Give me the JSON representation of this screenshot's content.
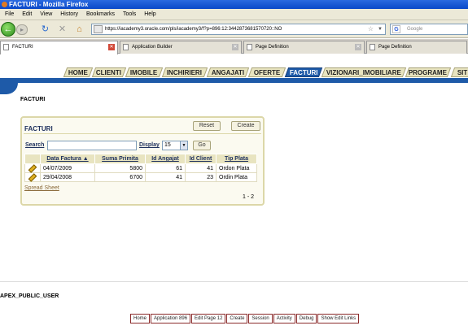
{
  "window": {
    "title": "FACTURI - Mozilla Firefox"
  },
  "menu": [
    "File",
    "Edit",
    "View",
    "History",
    "Bookmarks",
    "Tools",
    "Help"
  ],
  "nav": {
    "url": "https://iacademy3.oracle.com/pls/iacademy3/f?p=896:12:3442873681570720::NO",
    "search_placeholder": "Google"
  },
  "browser_tabs": [
    {
      "label": "FACTURI",
      "active": true
    },
    {
      "label": "Application Builder",
      "active": false
    },
    {
      "label": "Page Definition",
      "active": false
    },
    {
      "label": "Page Definition",
      "active": false
    }
  ],
  "app_tabs": [
    {
      "label": "HOME",
      "current": false
    },
    {
      "label": "CLIENTI",
      "current": false
    },
    {
      "label": "IMOBILE",
      "current": false
    },
    {
      "label": "INCHIRIERI",
      "current": false
    },
    {
      "label": "ANGAJATI",
      "current": false
    },
    {
      "label": "OFERTE",
      "current": false
    },
    {
      "label": "FACTURI",
      "current": true
    },
    {
      "label": "VIZIONARI_IMOBILIARE",
      "current": false
    },
    {
      "label": "PROGRAME",
      "current": false
    },
    {
      "label": "SIT",
      "current": false
    }
  ],
  "page": {
    "title": "FACTURI"
  },
  "region": {
    "title": "FACTURI",
    "reset_label": "Reset",
    "create_label": "Create",
    "search_label": "Search",
    "search_value": "",
    "display_label": "Display",
    "display_value": "15",
    "go_label": "Go",
    "columns": [
      "Data Factura ▲",
      "Suma Primita",
      "Id Angajat",
      "Id Client",
      "Tip Plata"
    ],
    "rows": [
      [
        "04/07/2009",
        "5800",
        "61",
        "41",
        "Ordon Plata"
      ],
      [
        "29/04/2008",
        "6700",
        "41",
        "23",
        "Ordin Plata"
      ]
    ],
    "spreadsheet_label": "Spread Sheet",
    "pagination": "1 - 2"
  },
  "user": "APEX_PUBLIC_USER",
  "dev_toolbar": [
    "Home",
    "Application 896",
    "Edit Page 12",
    "Create",
    "Session",
    "Activity",
    "Debug",
    "Show Edit Links"
  ]
}
